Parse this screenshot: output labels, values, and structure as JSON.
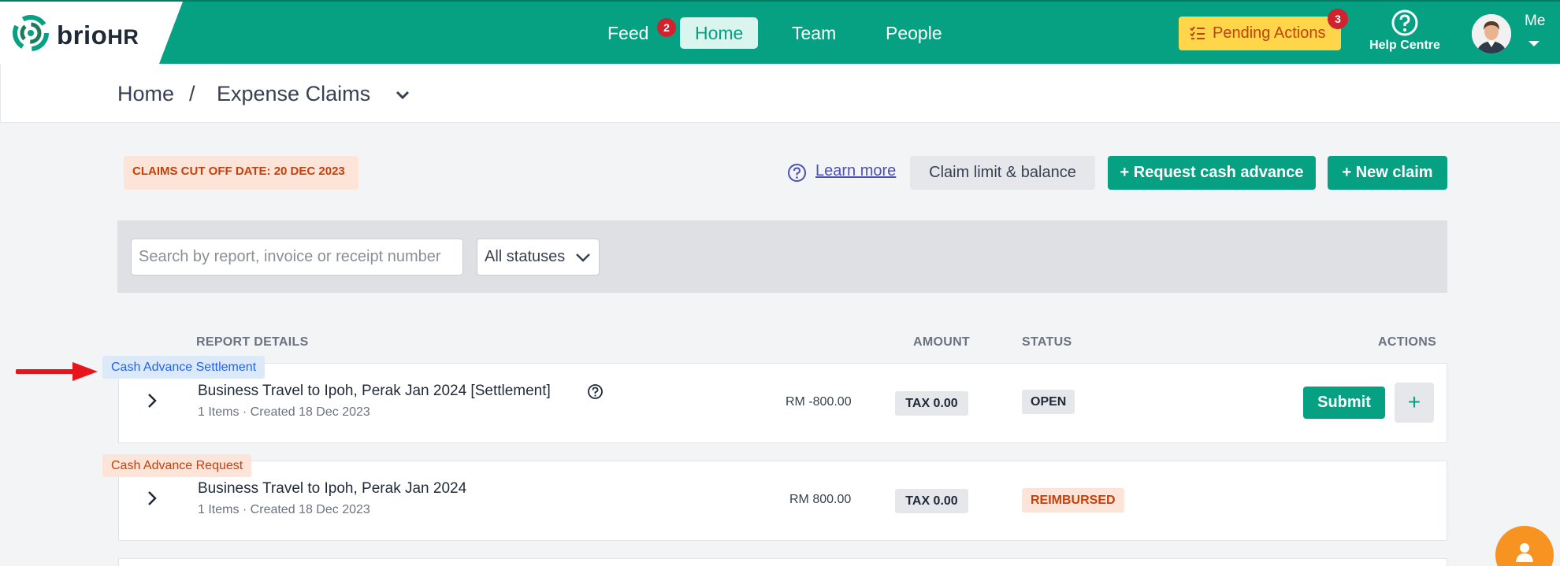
{
  "brand": {
    "name": "brio",
    "suffix": "HR"
  },
  "nav": {
    "feed": "Feed",
    "feed_badge": "2",
    "home": "Home",
    "team": "Team",
    "people": "People",
    "pending_actions": "Pending Actions",
    "pending_badge": "3",
    "help_centre": "Help Centre",
    "me": "Me"
  },
  "breadcrumb": {
    "home": "Home",
    "separator": "/",
    "current": "Expense Claims"
  },
  "toolbar": {
    "cutoff": "CLAIMS CUT OFF DATE: 20 DEC 2023",
    "learn_more": "Learn more",
    "claim_limit": "Claim limit & balance",
    "request_cash_advance": "+ Request cash advance",
    "new_claim": "+ New claim"
  },
  "filters": {
    "search_placeholder": "Search by report, invoice or receipt number",
    "status_value": "All statuses"
  },
  "table": {
    "headers": {
      "report": "REPORT DETAILS",
      "amount": "AMOUNT",
      "status": "STATUS",
      "actions": "ACTIONS"
    },
    "rows": [
      {
        "tag": "Cash Advance Settlement",
        "title": "Business Travel to Ipoh, Perak Jan 2024 [Settlement]",
        "subtitle": "1 Items · Created 18 Dec 2023",
        "amount": "RM -800.00",
        "tax": "TAX 0.00",
        "status": "OPEN",
        "submit": "Submit",
        "add": "+"
      },
      {
        "tag": "Cash Advance Request",
        "title": "Business Travel to Ipoh, Perak Jan 2024",
        "subtitle": "1 Items · Created 18 Dec 2023",
        "amount": "RM 800.00",
        "tax": "TAX 0.00",
        "status": "REIMBURSED"
      }
    ]
  },
  "colors": {
    "brand": "#05a182",
    "pending": "#ffd64a",
    "badge": "#d0232f",
    "arrow": "#e8141c",
    "fab": "#f79321"
  },
  "icons": [
    "brio-logo-icon",
    "checklist-icon",
    "help-circle-icon",
    "avatar",
    "chevron-down-icon",
    "question-circle-icon",
    "chevron-right-icon",
    "red-arrow",
    "support-person-icon"
  ]
}
